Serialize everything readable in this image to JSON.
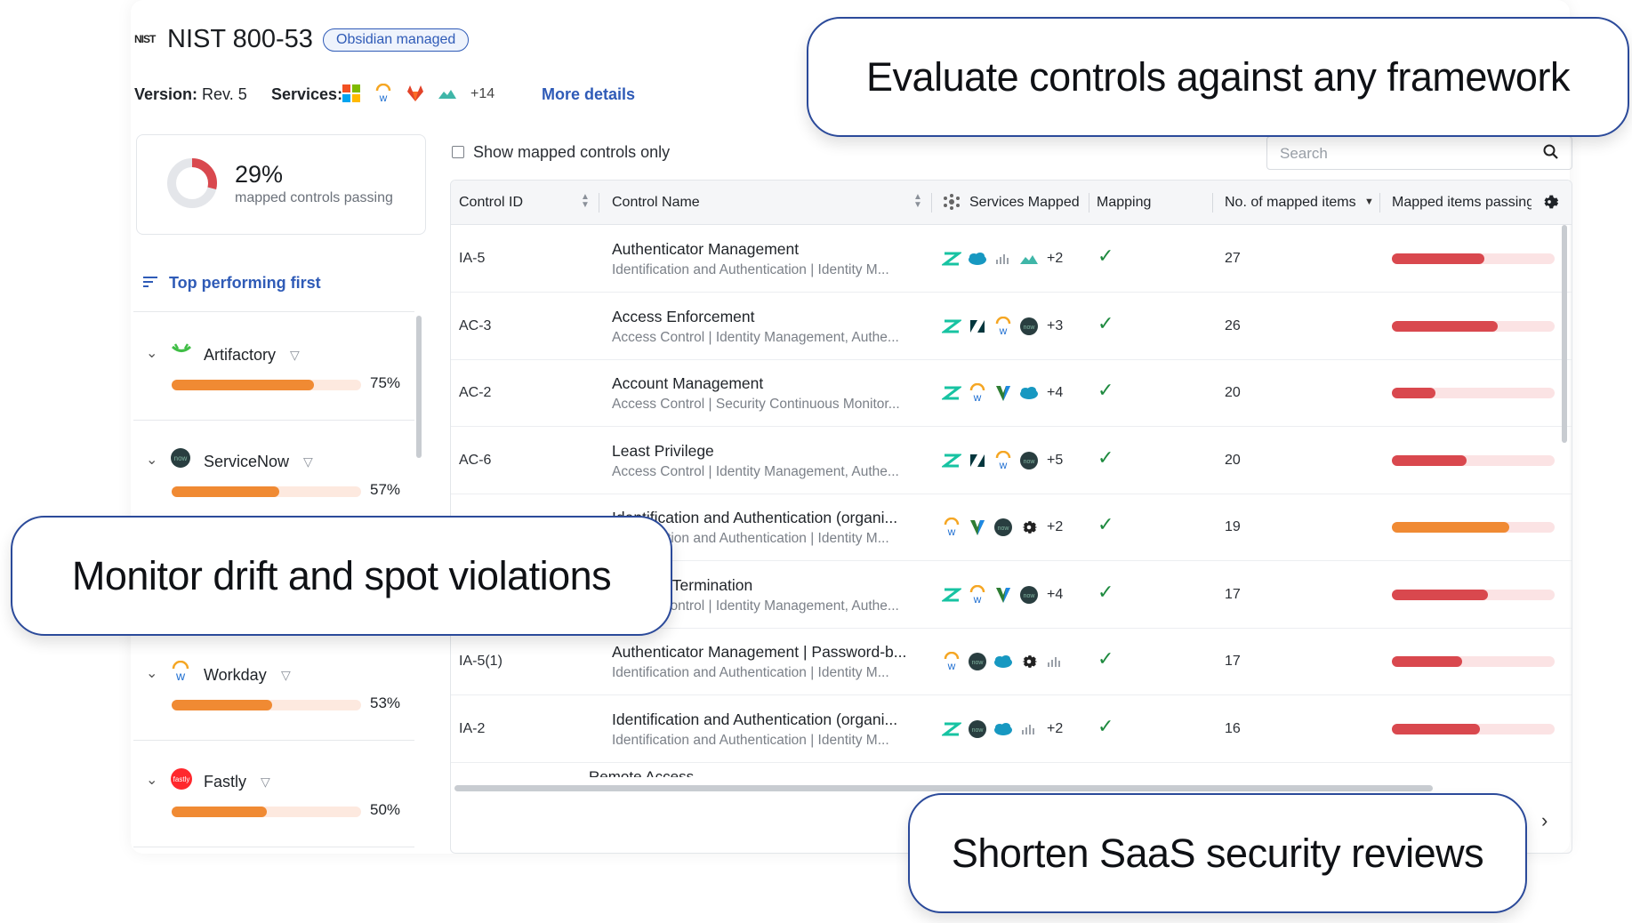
{
  "header": {
    "logo_text": "NIST",
    "title": "NIST 800-53",
    "badge": "Obsidian managed",
    "version_label": "Version:",
    "version_value": "Rev. 5",
    "services_label": "Services:",
    "services_more": "+14",
    "more_details": "More details"
  },
  "score": {
    "value": "29%",
    "label": "mapped controls passing",
    "fraction": 0.29,
    "color": "#d9484e"
  },
  "sort_label": "Top performing first",
  "services": [
    {
      "name": "Artifactory",
      "pct": "75%",
      "fraction": 0.75,
      "icon": "artifactory-icon"
    },
    {
      "name": "ServiceNow",
      "pct": "57%",
      "fraction": 0.57,
      "icon": "servicenow-icon"
    },
    {
      "name": "Workday",
      "pct": "53%",
      "fraction": 0.53,
      "icon": "workday-icon"
    },
    {
      "name": "Fastly",
      "pct": "50%",
      "fraction": 0.5,
      "icon": "fastly-icon"
    }
  ],
  "filter": {
    "show_mapped_label": "Show mapped controls only",
    "search_placeholder": "Search"
  },
  "table": {
    "columns": [
      "Control ID",
      "Control Name",
      "Services Mapped",
      "Mapping",
      "No. of mapped items",
      "Mapped items passing"
    ],
    "rows": [
      {
        "id": "IA-5",
        "name": "Authenticator Management",
        "sub": "Identification and Authentication  |  Identity M...",
        "icons": [
          "zendesk",
          "salesforce",
          "meraki",
          "okta-cloud"
        ],
        "more": "+2",
        "mapped": "✓",
        "items": "27",
        "passing": 0.57,
        "color": "#d9484e"
      },
      {
        "id": "AC-3",
        "name": "Access Enforcement",
        "sub": "Access Control  |  Identity Management, Authe...",
        "icons": [
          "zendesk",
          "zendesk-z",
          "workday",
          "servicenow"
        ],
        "more": "+3",
        "mapped": "✓",
        "items": "26",
        "passing": 0.65,
        "color": "#d9484e"
      },
      {
        "id": "AC-2",
        "name": "Account Management",
        "sub": "Access Control  |  Security Continuous Monitor...",
        "icons": [
          "zendesk",
          "workday",
          "vercel",
          "salesforce"
        ],
        "more": "+4",
        "mapped": "✓",
        "items": "20",
        "passing": 0.27,
        "color": "#d9484e"
      },
      {
        "id": "AC-6",
        "name": "Least Privilege",
        "sub": "Access Control  |  Identity Management, Authe...",
        "icons": [
          "zendesk",
          "zendesk-z",
          "workday",
          "servicenow"
        ],
        "more": "+5",
        "mapped": "✓",
        "items": "20",
        "passing": 0.46,
        "color": "#d9484e"
      },
      {
        "id": "",
        "name": "Identification and Authentication (organi...",
        "sub": "Identification and Authentication  |  Identity M...",
        "icons": [
          "workday",
          "vercel",
          "servicenow",
          "gear"
        ],
        "more": "+2",
        "mapped": "✓",
        "items": "19",
        "passing": 0.72,
        "color": "#f08a33"
      },
      {
        "id": "",
        "name": "Account Termination",
        "sub": "Access Control  |  Identity Management, Authe...",
        "icons": [
          "zendesk",
          "workday",
          "vercel",
          "servicenow"
        ],
        "more": "+4",
        "mapped": "✓",
        "items": "17",
        "passing": 0.59,
        "color": "#d9484e"
      },
      {
        "id": "IA-5(1)",
        "name": "Authenticator Management | Password-b...",
        "sub": "Identification and Authentication  |  Identity M...",
        "icons": [
          "workday",
          "servicenow",
          "salesforce",
          "gear",
          "meraki"
        ],
        "more": "",
        "mapped": "✓",
        "items": "17",
        "passing": 0.43,
        "color": "#d9484e"
      },
      {
        "id": "IA-2",
        "name": "Identification and Authentication (organi...",
        "sub": "Identification and Authentication  |  Identity M...",
        "icons": [
          "zendesk",
          "servicenow",
          "salesforce",
          "meraki"
        ],
        "more": "+2",
        "mapped": "✓",
        "items": "16",
        "passing": 0.54,
        "color": "#d9484e"
      }
    ],
    "partial_row_name": "Remote Access"
  },
  "callouts": {
    "top": "Evaluate controls against any framework",
    "left": "Monitor drift and spot violations",
    "bottom": "Shorten SaaS security reviews"
  }
}
